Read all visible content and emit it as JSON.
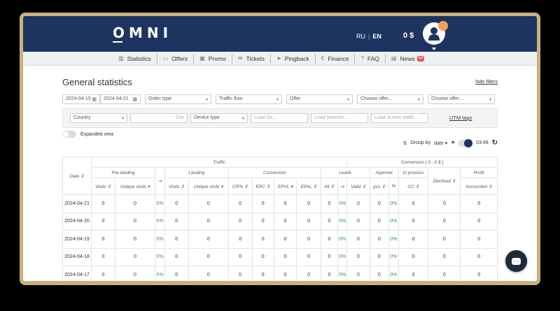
{
  "header": {
    "logo": "OMNI",
    "lang_ru": "RU",
    "lang_sep": "|",
    "lang_en": "EN",
    "balance": "0 $"
  },
  "nav": [
    {
      "icon": "chart-icon",
      "glyph": "▥",
      "label": "Statistics"
    },
    {
      "icon": "offers-icon",
      "glyph": "▭",
      "label": "Offers"
    },
    {
      "icon": "promo-icon",
      "glyph": "▦",
      "label": "Promo"
    },
    {
      "icon": "tickets-icon",
      "glyph": "✉",
      "label": "Tickets"
    },
    {
      "icon": "pingback-icon",
      "glyph": "➤",
      "label": "Pingback"
    },
    {
      "icon": "finance-icon",
      "glyph": "€",
      "label": "Finance"
    },
    {
      "icon": "faq-icon",
      "glyph": "?",
      "label": "FAQ"
    },
    {
      "icon": "news-icon",
      "glyph": "▤",
      "label": "News",
      "badge": "64"
    }
  ],
  "page": {
    "title": "General statistics",
    "hide_filters": "hide filters"
  },
  "filters": {
    "date_from": "2024-04-15",
    "date_to": "2024-04-21",
    "order_type": "Order type",
    "traffic_flow": "Traffic flow",
    "offer": "Offer",
    "choose_offer_1": "Choose offer...",
    "choose_offer_2": "Choose offer...",
    "country": "Country",
    "city": "City",
    "device_type": "Device type",
    "load_os": "Load Os...",
    "load_browser": "Load browser...",
    "load_screen": "Load screen width...",
    "utm_tags": "UTM tags"
  },
  "expanded_view": "Expanded view",
  "group_by": {
    "label": "Group by",
    "value": "date",
    "time": "03:49"
  },
  "table": {
    "group_traffic": "Traffic",
    "group_conversion_rate": "Conversion ( 0 , 0 $ )",
    "date": "Date",
    "prelanding": "Pre-landing",
    "landing": "Landing",
    "conversion": "Conversion",
    "leads": "Leads",
    "approve": "Approve",
    "in_process": "In process",
    "declined": "Declined",
    "profit": "Profit",
    "arrow": "⇒",
    "cols": {
      "visits": "Visits",
      "unique_visits": "Unique visits",
      "visits2": "Visits",
      "unique_visits2": "Unique visits",
      "cr": "CR%",
      "epc": "EPC",
      "epvl": "EPVL",
      "epal": "EPAL",
      "all": "All",
      "arrow2": "⇒",
      "valid": "Valid",
      "pcs": "pcs",
      "pct": "%",
      "cc": "CC",
      "accounted": "Accounted"
    },
    "rows": [
      {
        "date": "2024-04-21",
        "v": [
          "0",
          "0",
          "0%",
          "0",
          "0",
          "0",
          "0",
          "0",
          "0",
          "0",
          "0%",
          "0",
          "0",
          "0%",
          "0",
          "0",
          "0"
        ]
      },
      {
        "date": "2024-04-20",
        "v": [
          "0",
          "0",
          "0%",
          "0",
          "0",
          "0",
          "0",
          "0",
          "0",
          "0",
          "0%",
          "0",
          "0",
          "0%",
          "0",
          "0",
          "0"
        ]
      },
      {
        "date": "2024-04-19",
        "v": [
          "0",
          "0",
          "0%",
          "0",
          "0",
          "0",
          "0",
          "0",
          "0",
          "0",
          "0%",
          "0",
          "0",
          "0%",
          "0",
          "0",
          "0"
        ]
      },
      {
        "date": "2024-04-18",
        "v": [
          "0",
          "0",
          "0%",
          "0",
          "0",
          "0",
          "0",
          "0",
          "0",
          "0",
          "0%",
          "0",
          "0",
          "0%",
          "0",
          "0",
          "0"
        ]
      },
      {
        "date": "2024-04-17",
        "v": [
          "0",
          "0",
          "0%",
          "0",
          "0",
          "0",
          "0",
          "0",
          "0",
          "0",
          "0%",
          "0",
          "0",
          "0%",
          "0",
          "0",
          "0"
        ]
      }
    ]
  },
  "colors": {
    "header_bg": "#1d3461",
    "frame": "#c9b27c",
    "positive": "#3a9a3a",
    "badge": "#e04848"
  }
}
